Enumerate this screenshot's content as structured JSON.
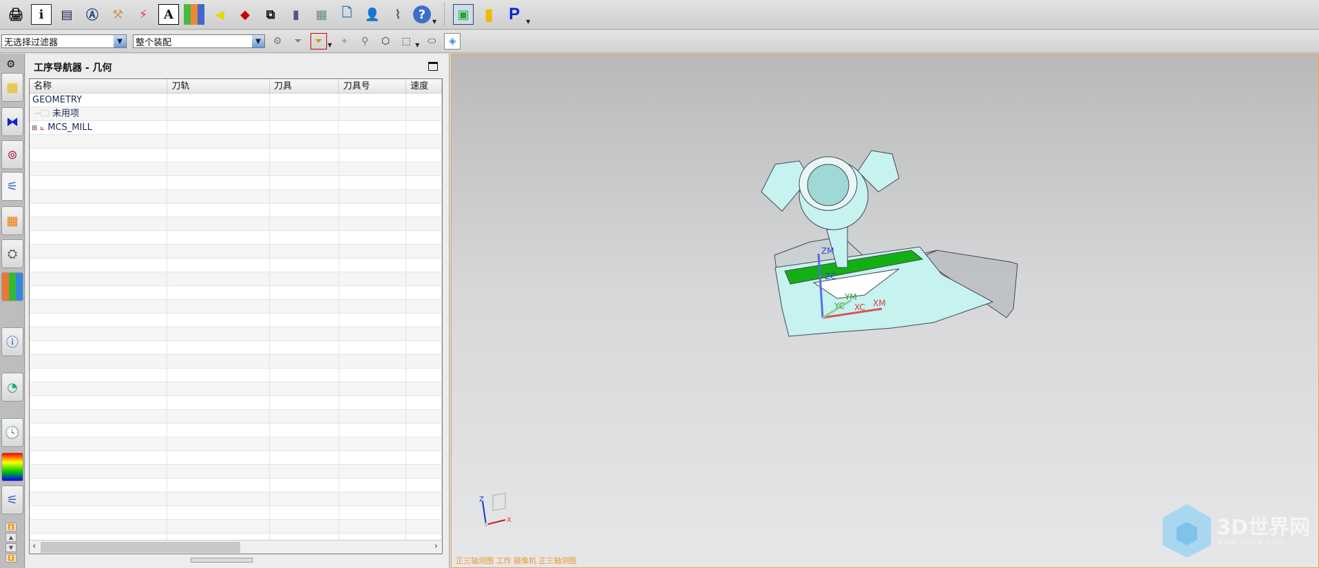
{
  "toolbar_main": {
    "icons": [
      "printer-icon",
      "info-icon",
      "save-layout-icon",
      "annotation-icon",
      "wrench-icon",
      "dimension-icon",
      "text-icon",
      "books-icon",
      "spotlight-icon",
      "eraser-icon",
      "copy-icon",
      "tool-bar-icon",
      "calculator-icon",
      "new-document-icon",
      "user-list-icon",
      "drill-icon",
      "help-icon"
    ],
    "icons2": [
      "machine-control-icon",
      "stock-icon",
      "post-processor-icon"
    ],
    "post_label": "P",
    "help_label": "?",
    "text_label": "A",
    "info_label": "i"
  },
  "toolbar_select": {
    "filter": "无选择过滤器",
    "scope": "整个装配"
  },
  "navigator": {
    "title": "工序导航器 - 几何",
    "columns": [
      "名称",
      "刀轨",
      "刀具",
      "刀具号",
      "速度"
    ],
    "rows": [
      {
        "name": "GEOMETRY"
      },
      {
        "name": "未用项"
      },
      {
        "name": "MCS_MILL"
      }
    ]
  },
  "viewport": {
    "status": "正三轴测图 工作 摄像机 正三轴测图",
    "axes": {
      "zm": "ZM",
      "zc": "ZC",
      "ym": "YM",
      "yc": "YC",
      "xc": "XC",
      "xm": "XM"
    },
    "triad": {
      "z": "Z",
      "x": "X"
    },
    "watermark": {
      "name": "3D世界网",
      "url": "WWW.3DSJW.COM"
    }
  },
  "colors": {
    "accent": "#f0962c",
    "model": "#c6f2ef",
    "green_face": "#12b012"
  }
}
